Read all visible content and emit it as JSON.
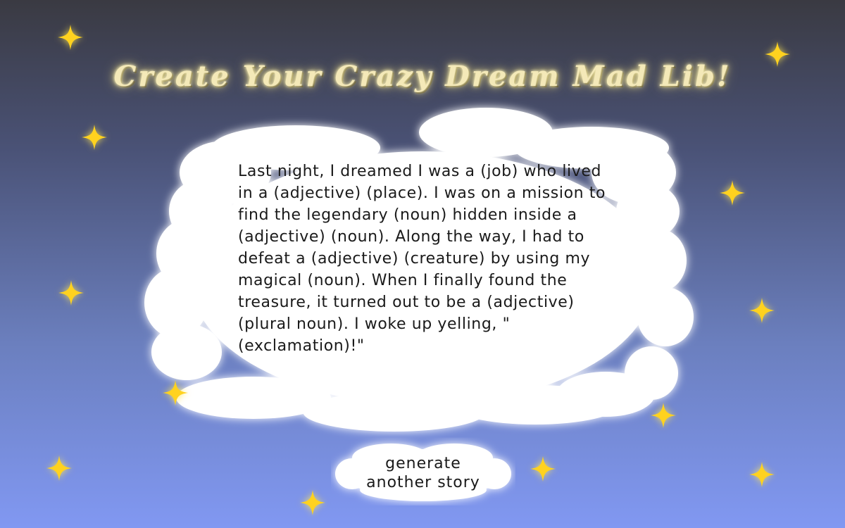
{
  "page": {
    "title": "Create Your Crazy Dream Mad Lib!"
  },
  "story": {
    "text": "Last night, I dreamed I was a (job) who lived in a (adjective) (place). I was on a mission to find the legendary (noun) hidden inside a (adjective) (noun). Along the way, I had to defeat a (adjective) (creature) by using my magical (noun). When I finally found the treasure, it turned out to be a (adjective) (plural noun). I woke up yelling, \"(exclamation)!\""
  },
  "generate_button": {
    "label_line1": "generate",
    "label_line2": "another story"
  },
  "decorations": {
    "sparkle_icon": "four-point-star",
    "sparkle_color": "#ffd21f",
    "cloud_color": "#ffffff"
  },
  "colors": {
    "background_top": "#3a3a42",
    "background_bottom": "#8198f2",
    "title_color": "#f4e9b8"
  }
}
